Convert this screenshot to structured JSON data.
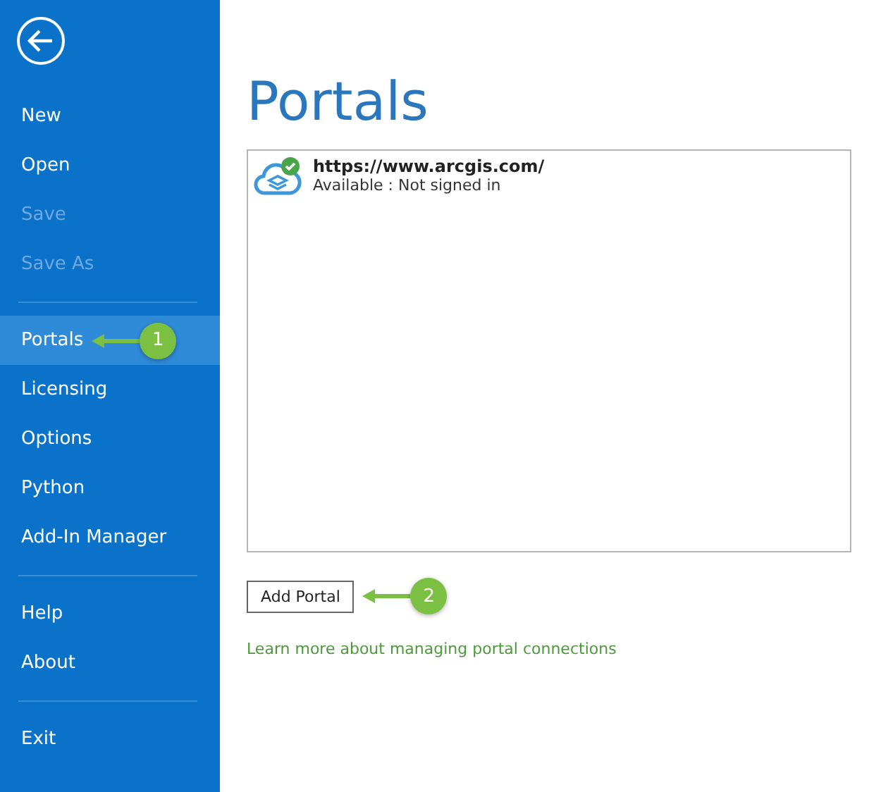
{
  "sidebar": {
    "groups": [
      [
        {
          "label": "New",
          "disabled": false,
          "selected": false
        },
        {
          "label": "Open",
          "disabled": false,
          "selected": false
        },
        {
          "label": "Save",
          "disabled": true,
          "selected": false
        },
        {
          "label": "Save As",
          "disabled": true,
          "selected": false
        }
      ],
      [
        {
          "label": "Portals",
          "disabled": false,
          "selected": true,
          "callout": "1"
        },
        {
          "label": "Licensing",
          "disabled": false,
          "selected": false
        },
        {
          "label": "Options",
          "disabled": false,
          "selected": false
        },
        {
          "label": "Python",
          "disabled": false,
          "selected": false
        },
        {
          "label": "Add-In Manager",
          "disabled": false,
          "selected": false
        }
      ],
      [
        {
          "label": "Help",
          "disabled": false,
          "selected": false
        },
        {
          "label": "About",
          "disabled": false,
          "selected": false
        }
      ],
      [
        {
          "label": "Exit",
          "disabled": false,
          "selected": false
        }
      ]
    ]
  },
  "title": "Portals",
  "portals": [
    {
      "url": "https://www.arcgis.com/",
      "status": "Available : Not signed in",
      "connected": true
    }
  ],
  "add_button": {
    "label": "Add Portal",
    "callout": "2"
  },
  "link": "Learn more about managing portal connections"
}
